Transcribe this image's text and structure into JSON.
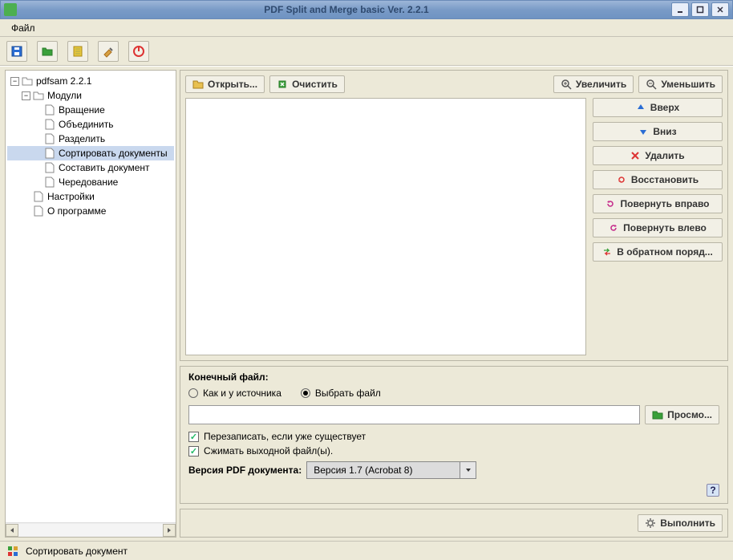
{
  "window": {
    "title": "PDF Split and Merge basic Ver. 2.2.1"
  },
  "menu": {
    "file": "Файл"
  },
  "tree": {
    "root": "pdfsam 2.2.1",
    "modules_label": "Модули",
    "items": {
      "rotate": "Вращение",
      "merge": "Объединить",
      "split": "Разделить",
      "sort": "Сортировать документы",
      "compose": "Составить документ",
      "alternate": "Чередование"
    },
    "settings": "Настройки",
    "about": "О программе"
  },
  "actions": {
    "open": "Открыть...",
    "clear": "Очистить",
    "zoom_in": "Увеличить",
    "zoom_out": "Уменьшить"
  },
  "sidebuttons": {
    "up": "Вверх",
    "down": "Вниз",
    "delete": "Удалить",
    "restore": "Восстановить",
    "rotate_right": "Повернуть вправо",
    "rotate_left": "Повернуть влево",
    "reverse": "В обратном поряд..."
  },
  "dest": {
    "title": "Конечный файл:",
    "same_source": "Как и у источника",
    "choose_file": "Выбрать файл",
    "path_value": "",
    "browse": "Просмо...",
    "overwrite": "Перезаписать, если уже существует",
    "compress": "Сжимать выходной файл(ы).",
    "version_label": "Версия PDF документа:",
    "version_value": "Версия 1.7 (Acrobat 8)",
    "help": "?"
  },
  "run": {
    "execute": "Выполнить"
  },
  "status": {
    "text": "Сортировать документ"
  }
}
